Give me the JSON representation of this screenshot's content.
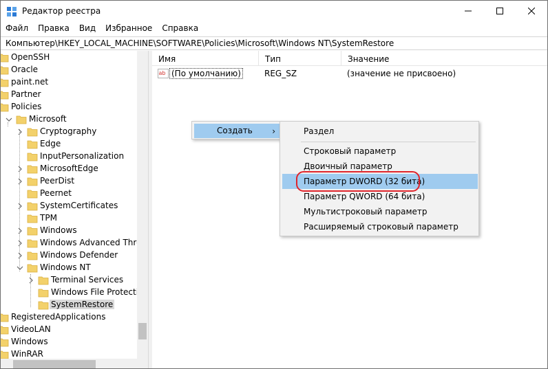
{
  "window": {
    "title": "Редактор реестра",
    "controls": {
      "minimize": "—",
      "maximize": "☐",
      "close": "✕"
    }
  },
  "menu": [
    "Файл",
    "Правка",
    "Вид",
    "Избранное",
    "Справка"
  ],
  "address": "Компьютер\\HKEY_LOCAL_MACHINE\\SOFTWARE\\Policies\\Microsoft\\Windows NT\\SystemRestore",
  "tree": [
    {
      "label": "OpenSSH",
      "level": 0,
      "expander": "none"
    },
    {
      "label": "Oracle",
      "level": 0,
      "expander": "none"
    },
    {
      "label": "paint.net",
      "level": 0,
      "expander": "none"
    },
    {
      "label": "Partner",
      "level": 0,
      "expander": "none"
    },
    {
      "label": "Policies",
      "level": 0,
      "expander": "none"
    },
    {
      "label": "Microsoft",
      "level": 1,
      "expander": "expanded"
    },
    {
      "label": "Cryptography",
      "level": 2,
      "expander": "collapsed"
    },
    {
      "label": "Edge",
      "level": 2,
      "expander": "none"
    },
    {
      "label": "InputPersonalization",
      "level": 2,
      "expander": "none"
    },
    {
      "label": "MicrosoftEdge",
      "level": 2,
      "expander": "collapsed"
    },
    {
      "label": "PeerDist",
      "level": 2,
      "expander": "collapsed"
    },
    {
      "label": "Peernet",
      "level": 2,
      "expander": "none"
    },
    {
      "label": "SystemCertificates",
      "level": 2,
      "expander": "collapsed"
    },
    {
      "label": "TPM",
      "level": 2,
      "expander": "none"
    },
    {
      "label": "Windows",
      "level": 2,
      "expander": "collapsed"
    },
    {
      "label": "Windows Advanced Threat",
      "level": 2,
      "expander": "collapsed"
    },
    {
      "label": "Windows Defender",
      "level": 2,
      "expander": "collapsed"
    },
    {
      "label": "Windows NT",
      "level": 2,
      "expander": "expanded"
    },
    {
      "label": "Terminal Services",
      "level": 3,
      "expander": "collapsed"
    },
    {
      "label": "Windows File Protection",
      "level": 3,
      "expander": "none"
    },
    {
      "label": "SystemRestore",
      "level": 3,
      "expander": "none",
      "selected": true
    },
    {
      "label": "RegisteredApplications",
      "level": 0,
      "expander": "none"
    },
    {
      "label": "VideoLAN",
      "level": 0,
      "expander": "none"
    },
    {
      "label": "Windows",
      "level": 0,
      "expander": "none"
    },
    {
      "label": "WinRAR",
      "level": 0,
      "expander": "none"
    }
  ],
  "list": {
    "columns": [
      "Имя",
      "Тип",
      "Значение"
    ],
    "rows": [
      {
        "icon": "ab",
        "name": "(По умолчанию)",
        "type": "REG_SZ",
        "value": "(значение не присвоено)"
      }
    ]
  },
  "context_menu": {
    "parent_label": "Создать",
    "parent_arrow": "›",
    "items": [
      {
        "label": "Раздел"
      },
      {
        "label": "Строковый параметр"
      },
      {
        "label": "Двоичный параметр"
      },
      {
        "label": "Параметр DWORD (32 бита)",
        "highlighted": true
      },
      {
        "label": "Параметр QWORD (64 бита)"
      },
      {
        "label": "Мультистроковый параметр"
      },
      {
        "label": "Расширяемый строковый параметр"
      }
    ]
  },
  "colors": {
    "highlight": "#9fcbef",
    "annotation": "#e0242b",
    "folder": "#f3d16b"
  }
}
